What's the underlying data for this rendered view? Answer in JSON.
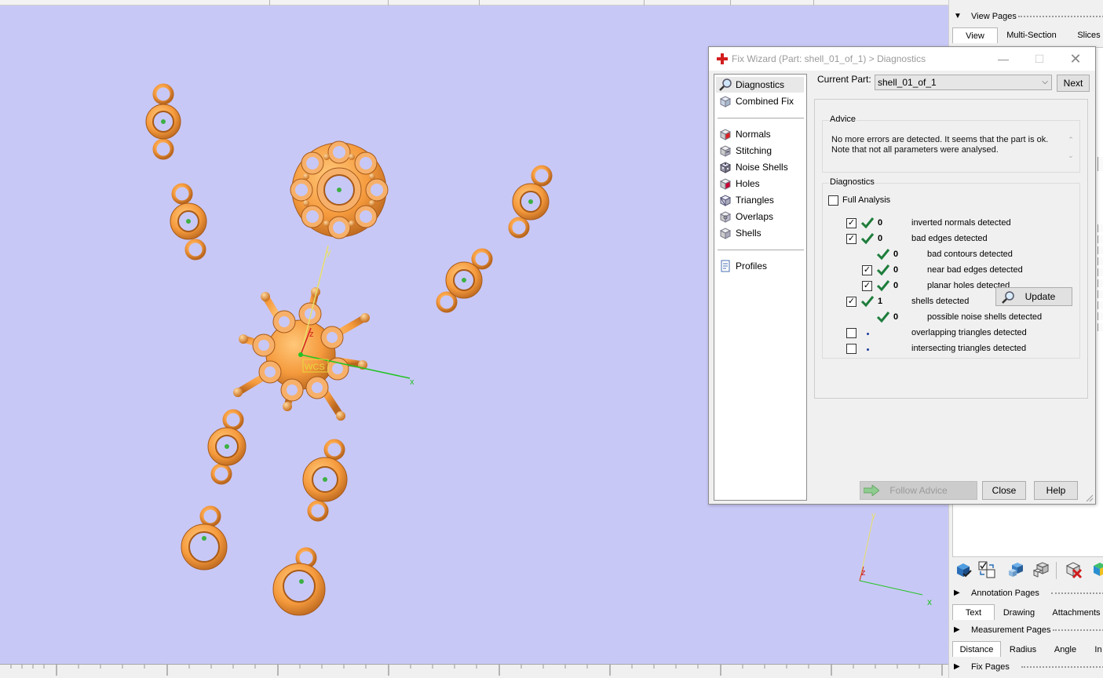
{
  "dialog": {
    "title": "Fix Wizard (Part: shell_01_of_1) > Diagnostics",
    "current_part_label": "Current Part:",
    "current_part_value": "shell_01_of_1",
    "next_label": "Next",
    "nav": {
      "diagnostics": "Diagnostics",
      "combined_fix": "Combined Fix",
      "normals": "Normals",
      "stitching": "Stitching",
      "noise_shells": "Noise Shells",
      "holes": "Holes",
      "triangles": "Triangles",
      "overlaps": "Overlaps",
      "shells": "Shells",
      "profiles": "Profiles"
    },
    "advice": {
      "label": "Advice",
      "line1": "No more errors are detected. It seems that the part is ok.",
      "line2": "Note that not all parameters were analysed."
    },
    "diagnostics": {
      "label": "Diagnostics",
      "full_analysis": "Full Analysis",
      "rows": [
        {
          "count": "0",
          "text": "inverted normals detected"
        },
        {
          "count": "0",
          "text": "bad edges detected"
        },
        {
          "count": "0",
          "text": "bad contours detected"
        },
        {
          "count": "0",
          "text": "near bad edges detected"
        },
        {
          "count": "0",
          "text": "planar holes detected"
        },
        {
          "count": "1",
          "text": "shells detected"
        },
        {
          "count": "0",
          "text": "possible noise shells detected"
        },
        {
          "count": "",
          "text": "overlapping triangles detected"
        },
        {
          "count": "",
          "text": "intersecting triangles detected"
        }
      ],
      "update_label": "Update"
    },
    "buttons": {
      "follow_advice": "Follow Advice",
      "close": "Close",
      "help": "Help"
    }
  },
  "viewport": {
    "axis_y": "y",
    "axis_z": "z",
    "axis_x": "x",
    "wcs_label": "WCS",
    "mini_axis_y": "y",
    "mini_axis_z": "z",
    "mini_axis_x": "x"
  },
  "sidepanel": {
    "view_pages": "View Pages",
    "tabs_view": [
      "View",
      "Multi-Section",
      "Slices"
    ],
    "annotation_pages": "Annotation Pages",
    "tabs_annotation": [
      "Text",
      "Drawing",
      "Attachments"
    ],
    "measurement_pages": "Measurement Pages",
    "tabs_measurement": [
      "Distance",
      "Radius",
      "Angle",
      "In"
    ],
    "fix_pages": "Fix Pages"
  },
  "colors": {
    "viewport_bg": "#c8c8f6",
    "part_orange": "#f5a04a",
    "check_green": "#1e7d3c"
  }
}
